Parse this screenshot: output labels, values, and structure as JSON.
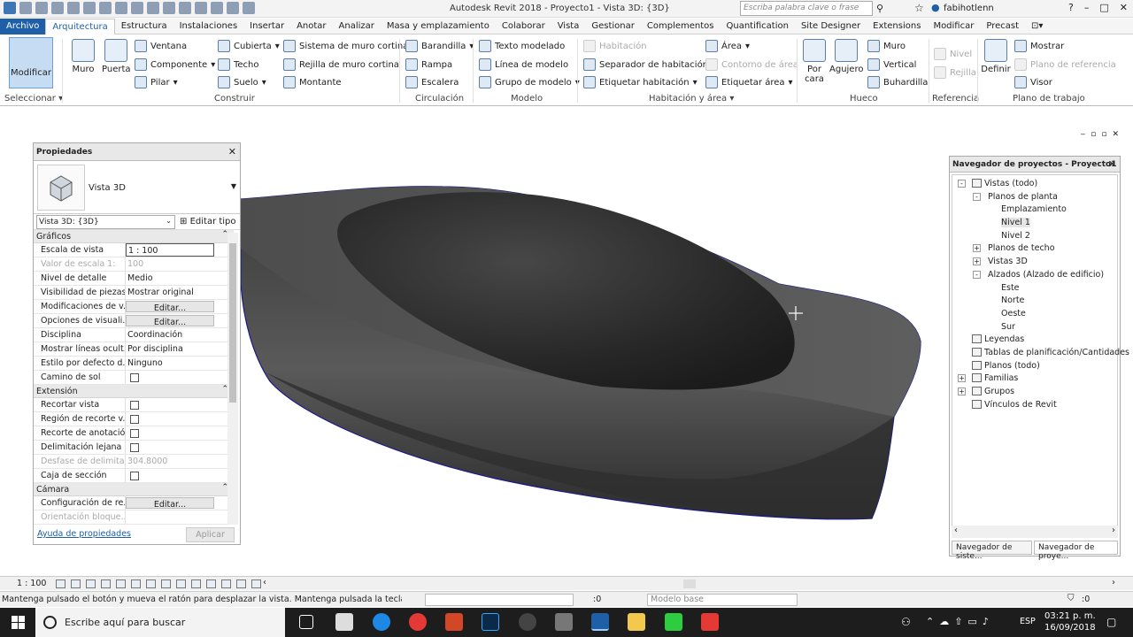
{
  "titlebar": {
    "app_title": "Autodesk Revit 2018 -    Proyecto1 - Vista 3D: {3D}",
    "search_placeholder": "Escriba palabra clave o frase",
    "user": "fabihotlenn"
  },
  "tabs": [
    "Archivo",
    "Arquitectura",
    "Estructura",
    "Instalaciones",
    "Insertar",
    "Anotar",
    "Analizar",
    "Masa y emplazamiento",
    "Colaborar",
    "Vista",
    "Gestionar",
    "Complementos",
    "Quantification",
    "Site Designer",
    "Extensions",
    "Modificar",
    "Precast"
  ],
  "ribbon": {
    "modify": "Modificar",
    "select": "Seleccionar",
    "wall": "Muro",
    "door": "Puerta",
    "window": "Ventana",
    "component": "Componente",
    "column": "Pilar",
    "roof": "Cubierta",
    "ceiling": "Techo",
    "floor": "Suelo",
    "curtain_system": "Sistema de muro cortina",
    "curtain_grid": "Rejilla de muro cortina",
    "mullion": "Montante",
    "build_label": "Construir",
    "railing": "Barandilla",
    "ramp": "Rampa",
    "stair": "Escalera",
    "circulation_label": "Circulación",
    "model_text": "Texto modelado",
    "model_line": "Línea de modelo",
    "model_group": "Grupo de modelo",
    "model_label": "Modelo",
    "room": "Habitación",
    "room_separator": "Separador de habitación",
    "tag_room": "Etiquetar habitación",
    "area": "Área",
    "area_boundary": "Contorno de área",
    "tag_area": "Etiquetar área",
    "room_area_label": "Habitación y área",
    "by_face": "Por cara",
    "shaft": "Agujero",
    "wall_opening": "Muro",
    "vertical": "Vertical",
    "dormer": "Buhardilla",
    "opening_label": "Hueco",
    "level": "Nivel",
    "grid": "Rejilla",
    "datum_label": "Referencia",
    "set": "Definir",
    "show": "Mostrar",
    "ref_plane": "Plano de referencia",
    "viewer": "Visor",
    "workplane_label": "Plano de trabajo"
  },
  "properties": {
    "title": "Propiedades",
    "type_name": "Vista 3D",
    "instance_selector": "Vista 3D: {3D}",
    "edit_type": "Editar tipo",
    "sections": [
      {
        "name": "Gráficos",
        "rows": [
          {
            "label": "Escala de vista",
            "value": "1 : 100",
            "kind": "box"
          },
          {
            "label": "Valor de escala    1:",
            "value": "100",
            "kind": "dis"
          },
          {
            "label": "Nivel de detalle",
            "value": "Medio"
          },
          {
            "label": "Visibilidad de piezas",
            "value": "Mostrar original"
          },
          {
            "label": "Modificaciones de v...",
            "value": "Editar...",
            "kind": "btn"
          },
          {
            "label": "Opciones de visuali...",
            "value": "Editar...",
            "kind": "btn"
          },
          {
            "label": "Disciplina",
            "value": "Coordinación"
          },
          {
            "label": "Mostrar líneas ocult...",
            "value": "Por disciplina"
          },
          {
            "label": "Estilo por defecto d...",
            "value": "Ninguno"
          },
          {
            "label": "Camino de sol",
            "value": "",
            "kind": "chk"
          }
        ]
      },
      {
        "name": "Extensión",
        "rows": [
          {
            "label": "Recortar vista",
            "value": "",
            "kind": "chk"
          },
          {
            "label": "Región de recorte v...",
            "value": "",
            "kind": "chk"
          },
          {
            "label": "Recorte de anotación",
            "value": "",
            "kind": "chk"
          },
          {
            "label": "Delimitación lejana ...",
            "value": "",
            "kind": "chk"
          },
          {
            "label": "Desfase de delimita...",
            "value": "304.8000",
            "kind": "dis"
          },
          {
            "label": "Caja de sección",
            "value": "",
            "kind": "chk"
          }
        ]
      },
      {
        "name": "Cámara",
        "rows": [
          {
            "label": "Configuración de re...",
            "value": "Editar...",
            "kind": "btn"
          },
          {
            "label": "Orientación bloque...",
            "value": "",
            "kind": "dis"
          }
        ]
      }
    ],
    "help": "Ayuda de propiedades",
    "apply": "Aplicar"
  },
  "browser": {
    "title": "Navegador de proyectos - Proyecto1",
    "tree": [
      {
        "label": "Vistas (todo)",
        "level": 0,
        "exp": "-",
        "icon": true
      },
      {
        "label": "Planos de planta",
        "level": 1,
        "exp": "-"
      },
      {
        "label": "Emplazamiento",
        "level": 2
      },
      {
        "label": "Nivel 1",
        "level": 2,
        "selected": true
      },
      {
        "label": "Nivel 2",
        "level": 2
      },
      {
        "label": "Planos de techo",
        "level": 1,
        "exp": "+"
      },
      {
        "label": "Vistas 3D",
        "level": 1,
        "exp": "+"
      },
      {
        "label": "Alzados (Alzado de edificio)",
        "level": 1,
        "exp": "-"
      },
      {
        "label": "Este",
        "level": 2
      },
      {
        "label": "Norte",
        "level": 2
      },
      {
        "label": "Oeste",
        "level": 2
      },
      {
        "label": "Sur",
        "level": 2
      },
      {
        "label": "Leyendas",
        "level": 0,
        "icon": true
      },
      {
        "label": "Tablas de planificación/Cantidades",
        "level": 0,
        "icon": true
      },
      {
        "label": "Planos (todo)",
        "level": 0,
        "icon": true
      },
      {
        "label": "Familias",
        "level": 0,
        "exp": "+",
        "icon": true
      },
      {
        "label": "Grupos",
        "level": 0,
        "exp": "+",
        "icon": true
      },
      {
        "label": "Vínculos de Revit",
        "level": 0,
        "icon": true
      }
    ],
    "tab_system": "Navegador de siste...",
    "tab_project": "Navegador de proye..."
  },
  "viewbar": {
    "scale": "1 : 100"
  },
  "status": {
    "message": "Mantenga pulsado el botón y mueva el ratón para desplazar la vista. Mantenga pulsada la tecla Ctrl para",
    "zero": ":0",
    "model_base": "Modelo base",
    "zero_right": ":0"
  },
  "taskbar": {
    "search": "Escribe aquí para buscar",
    "lang": "ESP",
    "time": "03:21 p. m.",
    "date": "16/09/2018"
  },
  "colors": {
    "accent": "#1e5fa8",
    "model_edge": "#1a1a8c",
    "taskbar": "#1d1d1d"
  }
}
